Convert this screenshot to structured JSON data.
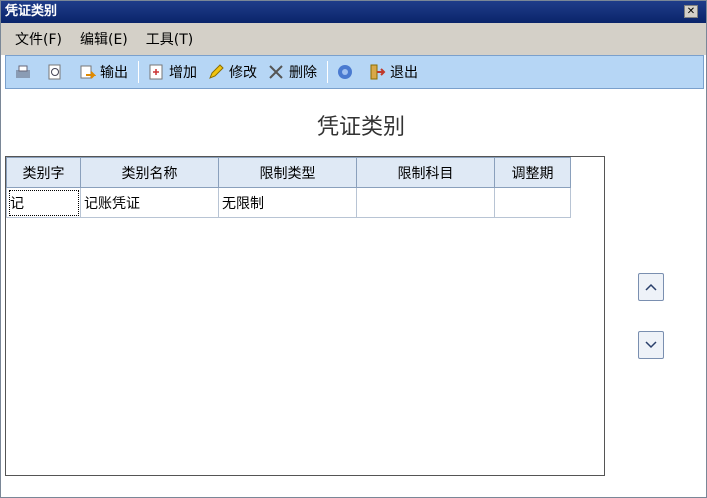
{
  "window": {
    "title": "凭证类别",
    "close_glyph": "✕"
  },
  "menu": [
    "文件(F)",
    "编辑(E)",
    "工具(T)"
  ],
  "toolbar": {
    "output": "输出",
    "add": "增加",
    "edit": "修改",
    "delete": "删除",
    "exit": "退出"
  },
  "heading": "凭证类别",
  "table": {
    "headers": [
      "类别字",
      "类别名称",
      "限制类型",
      "限制科目",
      "调整期"
    ],
    "rows": [
      [
        "记",
        "记账凭证",
        "无限制",
        "",
        ""
      ]
    ]
  },
  "scroll": {
    "up": "^",
    "down": "v"
  }
}
